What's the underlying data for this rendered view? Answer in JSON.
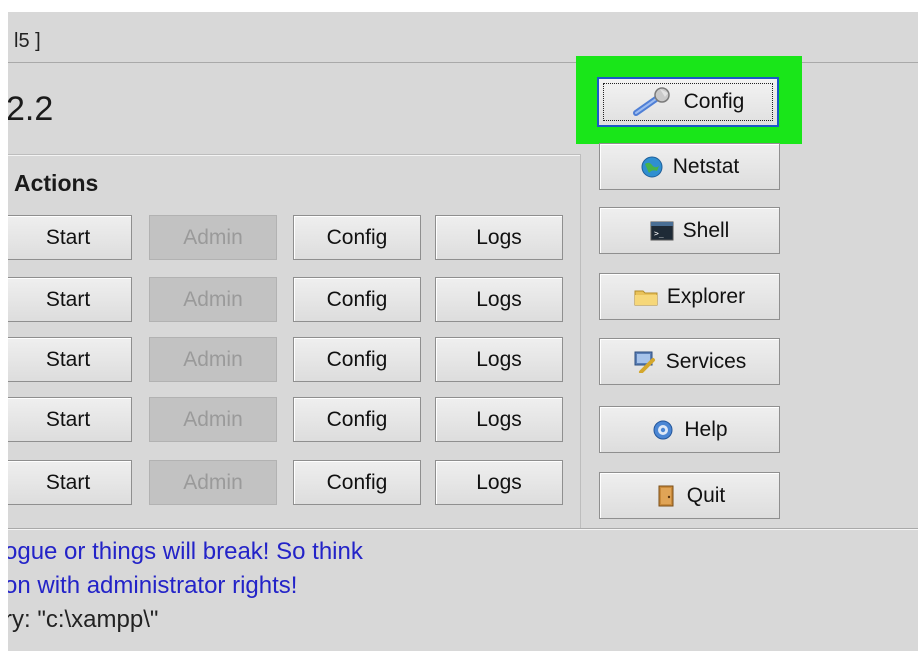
{
  "title_fragment": "l5 ]",
  "version_fragment": "2.2",
  "actions_title": "Actions",
  "module_rows": [
    {
      "start": "Start",
      "admin": "Admin",
      "config": "Config",
      "logs": "Logs"
    },
    {
      "start": "Start",
      "admin": "Admin",
      "config": "Config",
      "logs": "Logs"
    },
    {
      "start": "Start",
      "admin": "Admin",
      "config": "Config",
      "logs": "Logs"
    },
    {
      "start": "Start",
      "admin": "Admin",
      "config": "Config",
      "logs": "Logs"
    },
    {
      "start": "Start",
      "admin": "Admin",
      "config": "Config",
      "logs": "Logs"
    }
  ],
  "side_buttons": {
    "config": {
      "label": "Config",
      "icon": "wrench-icon"
    },
    "netstat": {
      "label": "Netstat",
      "icon": "globe-icon"
    },
    "shell": {
      "label": "Shell",
      "icon": "terminal-icon"
    },
    "explorer": {
      "label": "Explorer",
      "icon": "folder-icon"
    },
    "services": {
      "label": "Services",
      "icon": "services-icon"
    },
    "help": {
      "label": "Help",
      "icon": "help-icon"
    },
    "quit": {
      "label": "Quit",
      "icon": "door-icon"
    }
  },
  "log_lines": [
    {
      "text": "ogue or things will break! So think",
      "color": "#2323c8"
    },
    {
      "text": "on with administrator rights!",
      "color": "#2323c8"
    },
    {
      "text": "ry: \"c:\\xampp\\\"",
      "color": "#222222"
    }
  ],
  "colors": {
    "highlight": "#19e619",
    "focus_border": "#1b58c9",
    "panel": "#d8d8d8"
  }
}
